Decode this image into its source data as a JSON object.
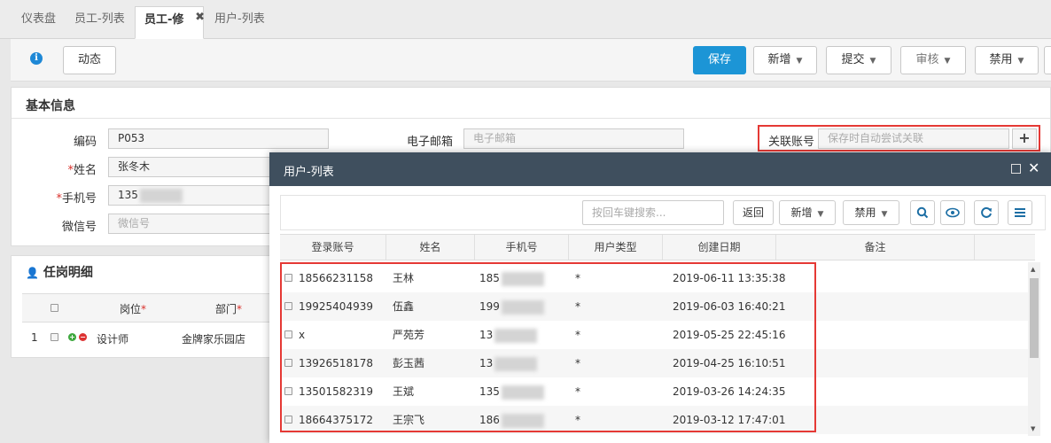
{
  "tabs": [
    {
      "label": "仪表盘",
      "active": false
    },
    {
      "label": "员工-列表",
      "active": false
    },
    {
      "label": "员工-修改",
      "active": true
    },
    {
      "label": "用户-列表",
      "active": false
    }
  ],
  "toolbar": {
    "dynamic_label": "动态",
    "save_label": "保存",
    "add_label": "新增",
    "submit_label": "提交",
    "review_label": "审核",
    "disable_label": "禁用"
  },
  "basic": {
    "title": "基本信息",
    "code_label": "编码",
    "code_value": "P053",
    "name_label": "姓名",
    "name_value": "张冬木",
    "phone_label": "手机号",
    "phone_value": "135",
    "wechat_label": "微信号",
    "wechat_placeholder": "微信号",
    "email_label": "电子邮箱",
    "email_placeholder": "电子邮箱",
    "account_label": "关联账号",
    "account_placeholder": "保存时自动尝试关联"
  },
  "job": {
    "title": "任岗明细",
    "col_post": "岗位",
    "col_dept": "部门",
    "row_index": "1",
    "row_post": "设计师",
    "row_dept": "金牌家乐园店"
  },
  "modal": {
    "title": "用户-列表",
    "search_placeholder": "按回车键搜索...",
    "back_label": "返回",
    "add_label": "新增",
    "disable_label": "禁用",
    "columns": [
      "登录账号",
      "姓名",
      "手机号",
      "用户类型",
      "创建日期",
      "备注"
    ],
    "rows": [
      {
        "account": "18566231158",
        "name": "王林",
        "phone": "185",
        "type": "*",
        "date": "2019-06-11 13:35:38"
      },
      {
        "account": "19925404939",
        "name": "伍鑫",
        "phone": "199",
        "type": "*",
        "date": "2019-06-03 16:40:21"
      },
      {
        "account": "x",
        "name": "严苑芳",
        "phone": "13",
        "type": "*",
        "date": "2019-05-25 22:45:16"
      },
      {
        "account": "13926518178",
        "name": "彭玉茜",
        "phone": "13",
        "type": "*",
        "date": "2019-04-25 16:10:51"
      },
      {
        "account": "13501582319",
        "name": "王斌",
        "phone": "135",
        "type": "*",
        "date": "2019-03-26 14:24:35"
      },
      {
        "account": "18664375172",
        "name": "王宗飞",
        "phone": "186",
        "type": "*",
        "date": "2019-03-12 17:47:01"
      }
    ]
  },
  "colors": {
    "primary": "#1c95d6",
    "modal_header": "#3f4f5e",
    "highlight": "#e53935"
  }
}
